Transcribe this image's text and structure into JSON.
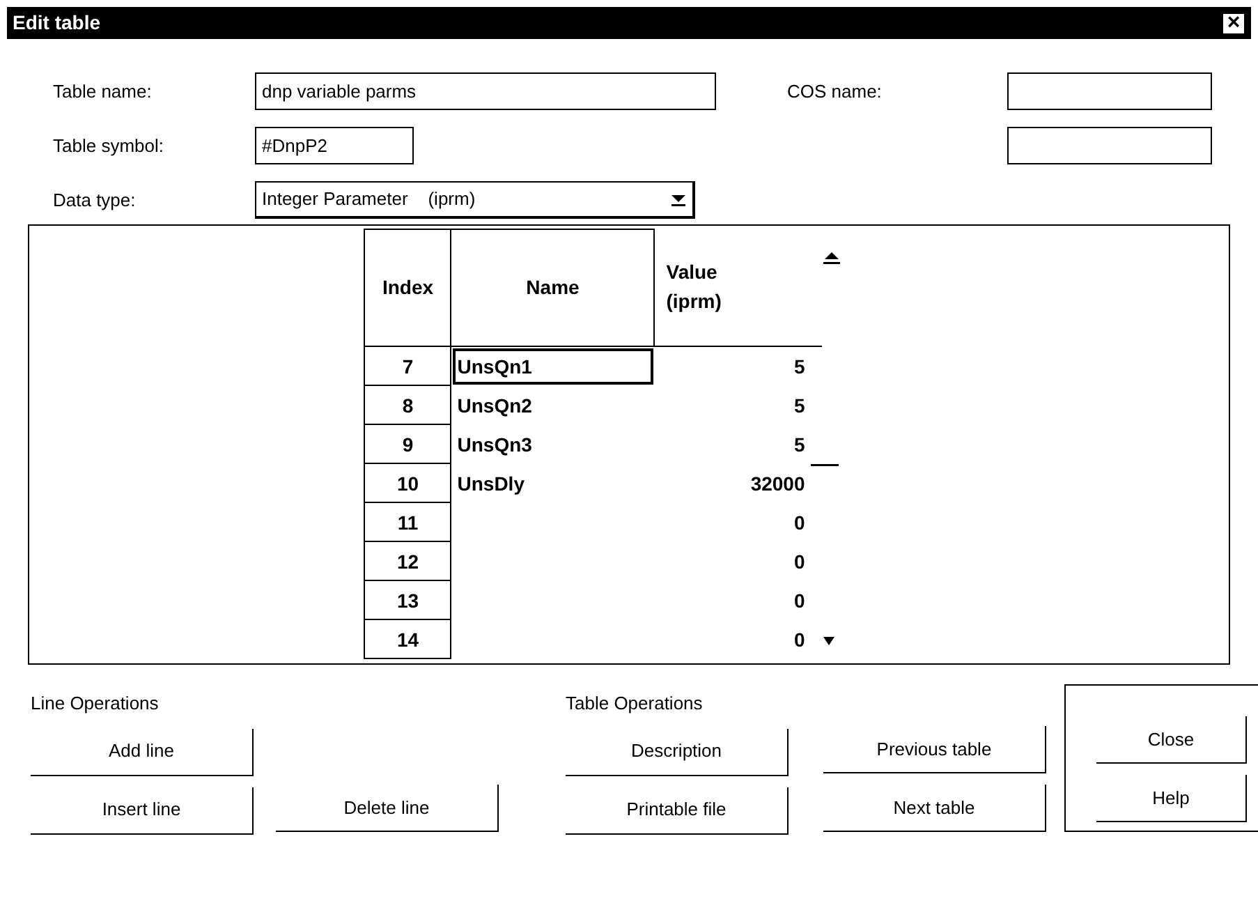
{
  "window": {
    "title": "Edit table",
    "close": "×"
  },
  "fields": [
    {
      "label": "Table name:",
      "value": "dnp variable parms"
    },
    {
      "label": "COS name:"
    },
    {
      "label": "Table symbol:",
      "value": "#DnpP2"
    },
    {
      "label": "Data type:",
      "value": "Integer Parameter    (iprm)"
    }
  ],
  "table": {
    "columns": [
      "Index",
      "Name",
      "Value\n(iprm)"
    ],
    "rows": [
      {
        "index": "7",
        "name": "UnsQn1",
        "value": "5",
        "selected": true
      },
      {
        "index": "8",
        "name": "UnsQn2",
        "value": "5",
        "selected": false
      },
      {
        "index": "9",
        "name": "UnsQn3",
        "value": "5",
        "selected": false
      },
      {
        "index": "10",
        "name": "UnsDly",
        "value": "32000",
        "selected": false
      },
      {
        "index": "11",
        "value": "0",
        "selected": false
      },
      {
        "index": "12",
        "value": "0",
        "selected": false
      },
      {
        "index": "13",
        "value": "0",
        "selected": false
      },
      {
        "index": "14",
        "value": "0",
        "selected": false
      }
    ]
  },
  "line_operations": {
    "title": "Line Operations",
    "buttons": [
      {
        "label": "Add line"
      },
      {
        "label": "Insert line"
      },
      {
        "label": "Delete line"
      }
    ]
  },
  "table_operations": {
    "title": "Table Operations",
    "buttons": [
      {
        "label": "Description"
      },
      {
        "label": "Previous table"
      },
      {
        "label": "Printable file"
      },
      {
        "label": "Next table"
      }
    ]
  },
  "dialog_buttons": [
    {
      "label": "Close"
    },
    {
      "label": "Help"
    }
  ]
}
